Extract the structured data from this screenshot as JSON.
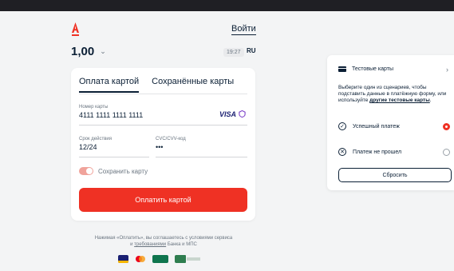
{
  "header": {
    "login_label": "Войти",
    "amount_int": "1",
    "amount_dec": ",00",
    "time": "19:27",
    "lang": "RU"
  },
  "payment": {
    "tabs": [
      {
        "label": "Оплата картой",
        "active": true
      },
      {
        "label": "Сохранённые карты",
        "active": false
      }
    ],
    "card_number": {
      "label": "Номер карты",
      "value": "4111 1111 1111 1111",
      "brand": "VISA"
    },
    "expiry": {
      "label": "Срок действия",
      "value": "12/24"
    },
    "cvc": {
      "label": "CVC/CVV-код",
      "value": "•••"
    },
    "save_card": {
      "label": "Сохранить карту",
      "on": true
    },
    "pay_button": "Оплатить картой"
  },
  "legal": {
    "line1": "Нажимая «Оплатить», вы соглашаетесь с условиями сервиса",
    "line2_pre": "и ",
    "line2_link": "требованиями",
    "line2_post": " Банка и МПС"
  },
  "test_panel": {
    "title": "Тестовые карты",
    "desc_text": "Выберите один из сценариев, чтобы подставить данные в платёжную форму, или используйте ",
    "desc_link": "другие тестовые карты",
    "desc_end": ".",
    "options": [
      {
        "label": "Успешный платеж",
        "icon": "check-circle-icon",
        "selected": true
      },
      {
        "label": "Платеж не прошел",
        "icon": "x-circle-icon",
        "selected": false
      }
    ],
    "reset_label": "Сбросить"
  },
  "colors": {
    "accent": "#ef3124",
    "text": "#0b1f35",
    "background": "#f3f4f5"
  }
}
